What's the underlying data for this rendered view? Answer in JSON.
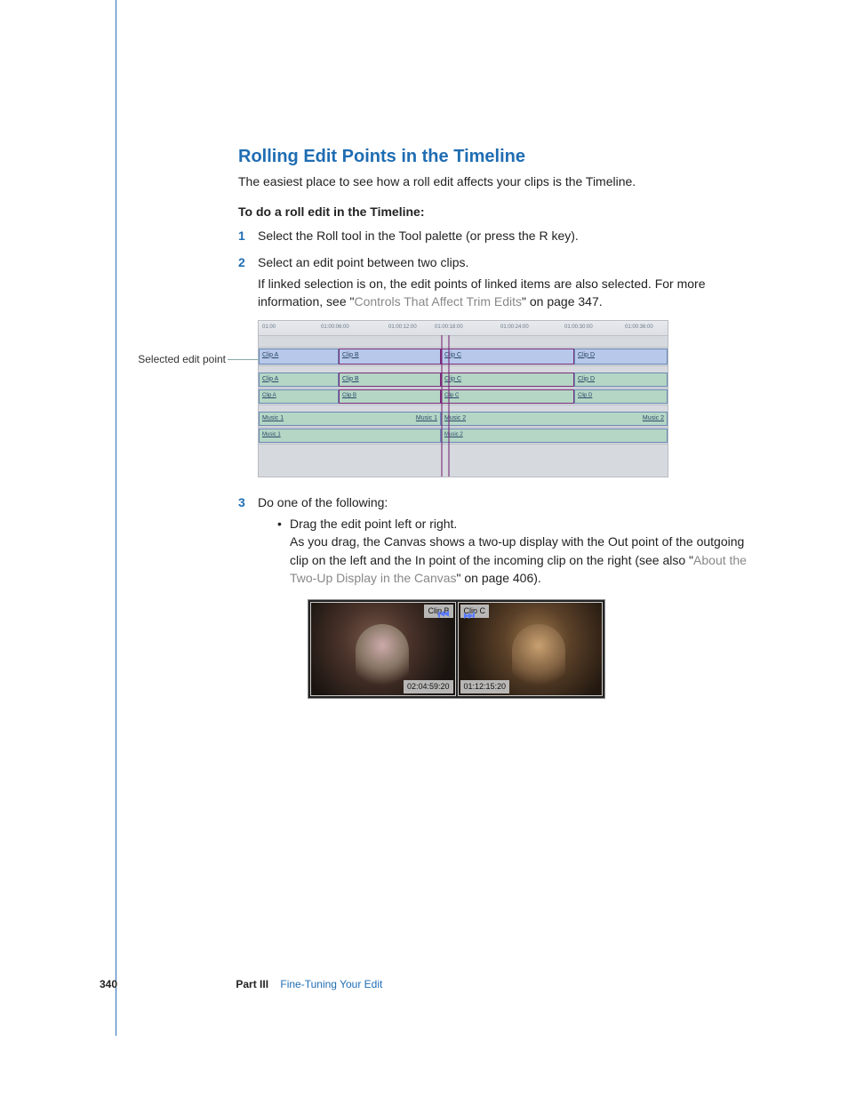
{
  "heading": "Rolling Edit Points in the Timeline",
  "intro": "The easiest place to see how a roll edit affects your clips is the Timeline.",
  "procedure_title": "To do a roll edit in the Timeline:",
  "steps": {
    "s1": {
      "num": "1",
      "text": "Select the Roll tool in the Tool palette (or press the R key)."
    },
    "s2": {
      "num": "2",
      "text": "Select an edit point between two clips.",
      "note_pre": "If linked selection is on, the edit points of linked items are also selected. For more information, see \"",
      "note_link": "Controls That Affect Trim Edits",
      "note_post": "\" on page 347."
    },
    "s3": {
      "num": "3",
      "text": "Do one of the following:",
      "bullet": "Drag the edit point left or right.",
      "bullet_body_pre": "As you drag, the Canvas shows a two-up display with the Out point of the outgoing clip on the left and the In point of the incoming clip on the right (see also \"",
      "bullet_body_link": "About the Two-Up Display in the Canvas",
      "bullet_body_post": "\" on page 406)."
    }
  },
  "callout": "Selected edit point",
  "timeline": {
    "ticks": [
      "01:00",
      "01:00:06:00",
      "01:00:12:00",
      "01:00:18:00",
      "01:00:24:00",
      "01:00:30:00",
      "01:00:36:00"
    ],
    "video_clips": [
      "Clip A",
      "Clip B",
      "Clip C",
      "Clip D"
    ],
    "audio_clips": [
      "Music 1",
      "Music 1",
      "Music 2",
      "Music 2"
    ]
  },
  "twoup": {
    "left_label": "Clip B",
    "left_tc": "02:04:59:20",
    "right_label": "Clip C",
    "right_tc": "01:12:15:20"
  },
  "footer": {
    "page": "340",
    "part": "Part III",
    "chapter": "Fine-Tuning Your Edit"
  }
}
